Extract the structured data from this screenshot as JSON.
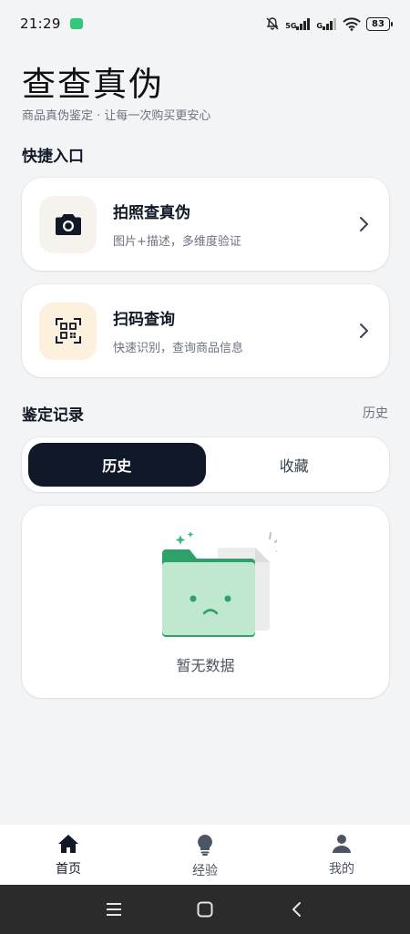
{
  "status_bar": {
    "time": "21:29",
    "network_5g": "5G",
    "network_g": "G",
    "battery": "83"
  },
  "header": {
    "title": "查查真伪",
    "subtitle": "商品真伪鉴定 · 让每一次购买更安心"
  },
  "quick_entry": {
    "section_title": "快捷入口",
    "items": [
      {
        "title": "拍照查真伪",
        "desc": "图片+描述，多维度验证",
        "icon": "camera-icon",
        "icon_bg": "#f6f3ee"
      },
      {
        "title": "扫码查询",
        "desc": "快速识别，查询商品信息",
        "icon": "qr-scan-icon",
        "icon_bg": "#fdf0dc"
      }
    ]
  },
  "records": {
    "section_title": "鉴定记录",
    "link": "历史",
    "tabs": [
      {
        "label": "历史",
        "active": true
      },
      {
        "label": "收藏",
        "active": false
      }
    ],
    "empty_text": "暂无数据"
  },
  "bottom_nav": {
    "items": [
      {
        "label": "首页",
        "icon": "home-icon",
        "active": true
      },
      {
        "label": "经验",
        "icon": "lightbulb-icon",
        "active": false
      },
      {
        "label": "我的",
        "icon": "user-icon",
        "active": false
      }
    ]
  },
  "colors": {
    "accent_dark": "#111827",
    "folder_green": "#2ea06a",
    "folder_light": "#bfe8cf"
  }
}
